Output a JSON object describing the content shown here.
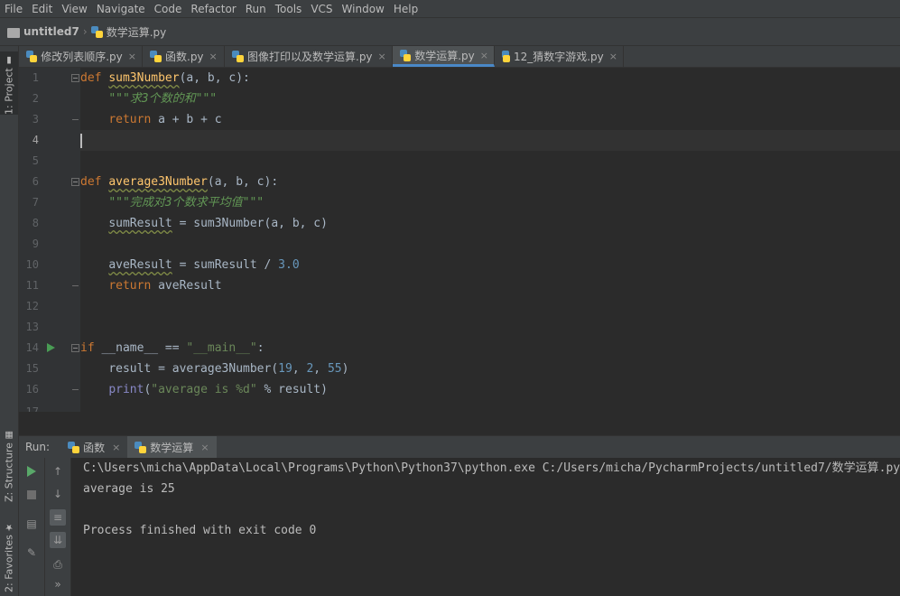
{
  "menu": [
    "File",
    "Edit",
    "View",
    "Navigate",
    "Code",
    "Refactor",
    "Run",
    "Tools",
    "VCS",
    "Window",
    "Help"
  ],
  "breadcrumb": {
    "project": "untitled7",
    "file": "数学运算.py"
  },
  "side_tabs": {
    "project": "1: Project",
    "structure": "Z: Structure",
    "favorites": "2: Favorites"
  },
  "tabs": [
    {
      "label": "修改列表顺序.py"
    },
    {
      "label": "函数.py"
    },
    {
      "label": "图像打印以及数学运算.py"
    },
    {
      "label": "数学运算.py",
      "active": true
    },
    {
      "label": "12_猜数字游戏.py"
    }
  ],
  "close_glyph": "×",
  "line_numbers": [
    "1",
    "2",
    "3",
    "4",
    "5",
    "6",
    "7",
    "8",
    "9",
    "10",
    "11",
    "12",
    "13",
    "14",
    "15",
    "16",
    "17"
  ],
  "code": {
    "l1": {
      "kw": "def",
      "fn": "sum3Number",
      "rest": "(a, b, c):"
    },
    "l2": {
      "doc": "\"\"\"求3个数的和\"\"\""
    },
    "l3": {
      "kw": "return",
      "rest": " a + b + c"
    },
    "l6": {
      "kw": "def",
      "fn": "average3Number",
      "rest": "(a, b, c):"
    },
    "l7": {
      "doc": "\"\"\"完成对3个数求平均值\"\"\""
    },
    "l8": {
      "var": "sumResult",
      "rest": " = sum3Number(a, b, c)"
    },
    "l10": {
      "var": "aveResult",
      "rest": " = sumResult / ",
      "num": "3.0"
    },
    "l11": {
      "kw": "return",
      "rest": " aveResult"
    },
    "l14": {
      "kw": "if",
      "rest": " __name__ == ",
      "str": "\"__main__\"",
      "end": ":"
    },
    "l15": {
      "rest": "result = average3Number(",
      "n1": "19",
      "c1": ", ",
      "n2": "2",
      "c2": ", ",
      "n3": "55",
      "end": ")"
    },
    "l16": {
      "builtin": "print",
      "p1": "(",
      "str": "\"average is %d\"",
      "rest": " % result)"
    }
  },
  "run": {
    "label": "Run:",
    "tabs": [
      {
        "label": "函数"
      },
      {
        "label": "数学运算",
        "active": true
      }
    ],
    "output": [
      "C:\\Users\\micha\\AppData\\Local\\Programs\\Python\\Python37\\python.exe C:/Users/micha/PycharmProjects/untitled7/数学运算.py",
      "average is 25",
      "",
      "Process finished with exit code 0"
    ]
  },
  "colors": {
    "keyword": "#cc7832",
    "function": "#ffc66d",
    "docstring": "#629755",
    "number": "#6897bb",
    "string": "#6a8759",
    "active_tab_underline": "#4a88c7"
  }
}
